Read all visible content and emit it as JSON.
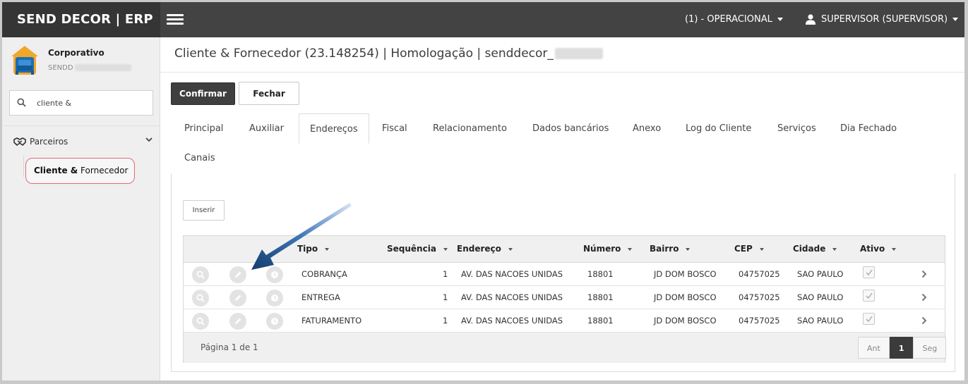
{
  "app": {
    "title": "SEND DECOR | ERP"
  },
  "topbar": {
    "menu_icon": "hamburger-icon",
    "company_selector": "(1) - OPERACIONAL",
    "user_menu": "SUPERVISOR (SUPERVISOR)",
    "user_icon": "user-icon"
  },
  "sidebar": {
    "company_name": "Corporativo",
    "company_sub": "SENDD",
    "search": {
      "value": "cliente &",
      "icon": "search-icon"
    },
    "group": {
      "label": "Parceiros",
      "icon": "handshake-icon",
      "expanded": true
    },
    "active_item": {
      "bold": "Cliente &",
      "rest": " Fornecedor"
    }
  },
  "main": {
    "title": "Cliente & Fornecedor (23.148254) | Homologação | senddecor_",
    "actions": {
      "confirm": "Confirmar",
      "close": "Fechar"
    },
    "tabs": [
      {
        "label": "Principal"
      },
      {
        "label": "Auxiliar"
      },
      {
        "label": "Endereços",
        "active": true
      },
      {
        "label": "Fiscal"
      },
      {
        "label": "Relacionamento"
      },
      {
        "label": "Dados bancários"
      },
      {
        "label": "Anexo"
      },
      {
        "label": "Log do Cliente"
      },
      {
        "label": "Serviços"
      },
      {
        "label": "Dia Fechado"
      },
      {
        "label": "Canais"
      }
    ],
    "insert_label": "Inserir",
    "grid": {
      "columns": [
        "Tipo",
        "Sequência",
        "Endereço",
        "Número",
        "Bairro",
        "CEP",
        "Cidade",
        "Ativo"
      ],
      "rows": [
        {
          "tipo": "COBRANÇA",
          "sequencia": "1",
          "endereco": "AV. DAS NACOES UNIDAS",
          "numero": "18801",
          "bairro": "JD DOM BOSCO",
          "cep": "04757025",
          "cidade": "SAO PAULO",
          "ativo": true
        },
        {
          "tipo": "ENTREGA",
          "sequencia": "1",
          "endereco": "AV. DAS NACOES UNIDAS",
          "numero": "18801",
          "bairro": "JD DOM BOSCO",
          "cep": "04757025",
          "cidade": "SAO PAULO",
          "ativo": true
        },
        {
          "tipo": "FATURAMENTO",
          "sequencia": "1",
          "endereco": "AV. DAS NACOES UNIDAS",
          "numero": "18801",
          "bairro": "JD DOM BOSCO",
          "cep": "04757025",
          "cidade": "SAO PAULO",
          "ativo": true
        }
      ],
      "row_actions": [
        "search-icon",
        "edit-pencil-icon",
        "history-clock-icon"
      ],
      "page_info": "Página 1 de 1",
      "pager": {
        "prev": "Ant",
        "current": "1",
        "next": "Seg"
      }
    }
  },
  "colors": {
    "topbar": "#434343",
    "brand_bg": "#353535",
    "highlight": "#e06a78",
    "arrow": "#1d4f86"
  }
}
